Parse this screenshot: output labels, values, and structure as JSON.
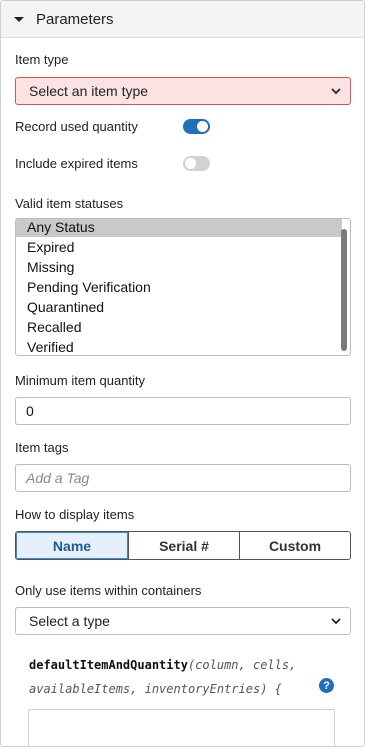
{
  "header": {
    "title": "Parameters"
  },
  "item_type": {
    "label": "Item type",
    "value": "Select an item type"
  },
  "record_used_quantity": {
    "label": "Record used quantity",
    "enabled": true
  },
  "include_expired": {
    "label": "Include expired items",
    "enabled": false
  },
  "valid_statuses": {
    "label": "Valid item statuses",
    "options": [
      "Any Status",
      "Expired",
      "Missing",
      "Pending Verification",
      "Quarantined",
      "Recalled",
      "Verified"
    ],
    "selected": "Any Status"
  },
  "min_quantity": {
    "label": "Minimum item quantity",
    "value": "0"
  },
  "item_tags": {
    "label": "Item tags",
    "placeholder": "Add a Tag"
  },
  "display_items": {
    "label": "How to display items",
    "options": [
      "Name",
      "Serial #",
      "Custom"
    ],
    "selected": "Name"
  },
  "containers": {
    "label": "Only use items within containers",
    "value": "Select a type"
  },
  "code": {
    "function_name": "defaultItemAndQuantity",
    "params_line1": "(column, cells,",
    "params_line2": "availableItems, inventoryEntries) {",
    "help_icon_label": "?"
  }
}
